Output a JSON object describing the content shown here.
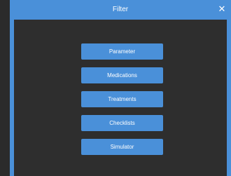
{
  "window": {
    "title": "Filter",
    "close_glyph": "✕"
  },
  "buttons": [
    {
      "label": "Parameter"
    },
    {
      "label": "Medications"
    },
    {
      "label": "Treatments"
    },
    {
      "label": "Checklists"
    },
    {
      "label": "Simulator"
    }
  ],
  "colors": {
    "accent": "#4a90d9",
    "background": "#2e2e2e",
    "text": "#ffffff"
  },
  "icons": {
    "close": "close-icon"
  }
}
